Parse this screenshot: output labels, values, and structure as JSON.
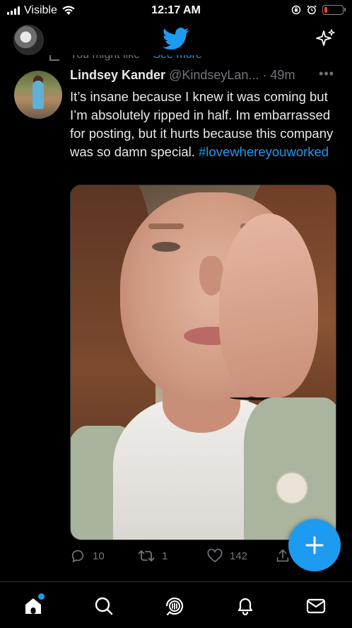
{
  "status_bar": {
    "carrier": "Visible",
    "time": "12:17 AM"
  },
  "header": {
    "logo_icon": "twitter-bird-icon",
    "sparkle_icon": "sparkle-icon"
  },
  "peek": {
    "text": "You might like",
    "link": "See more"
  },
  "tweet": {
    "display_name": "Lindsey Kander",
    "handle": "@KindseyLan...",
    "separator": " · ",
    "time_ago": "49m",
    "more": "•••",
    "text": "It’s insane because I knew it was coming but I’m absolutely ripped in half. Im embarrassed for posting, but it hurts because this company was so damn special. ",
    "hashtag": "#lovewhereyouworked",
    "actions": {
      "reply_count": "10",
      "retweet_count": "1",
      "like_count": "142"
    }
  },
  "fab": {
    "icon": "plus-icon"
  },
  "bottom_nav": {
    "items": [
      "home-icon",
      "search-icon",
      "spaces-icon",
      "notifications-icon",
      "messages-icon"
    ]
  },
  "colors": {
    "accent": "#1d9bf0",
    "muted": "#71767b",
    "text": "#e7e9ea",
    "background": "#000000"
  }
}
